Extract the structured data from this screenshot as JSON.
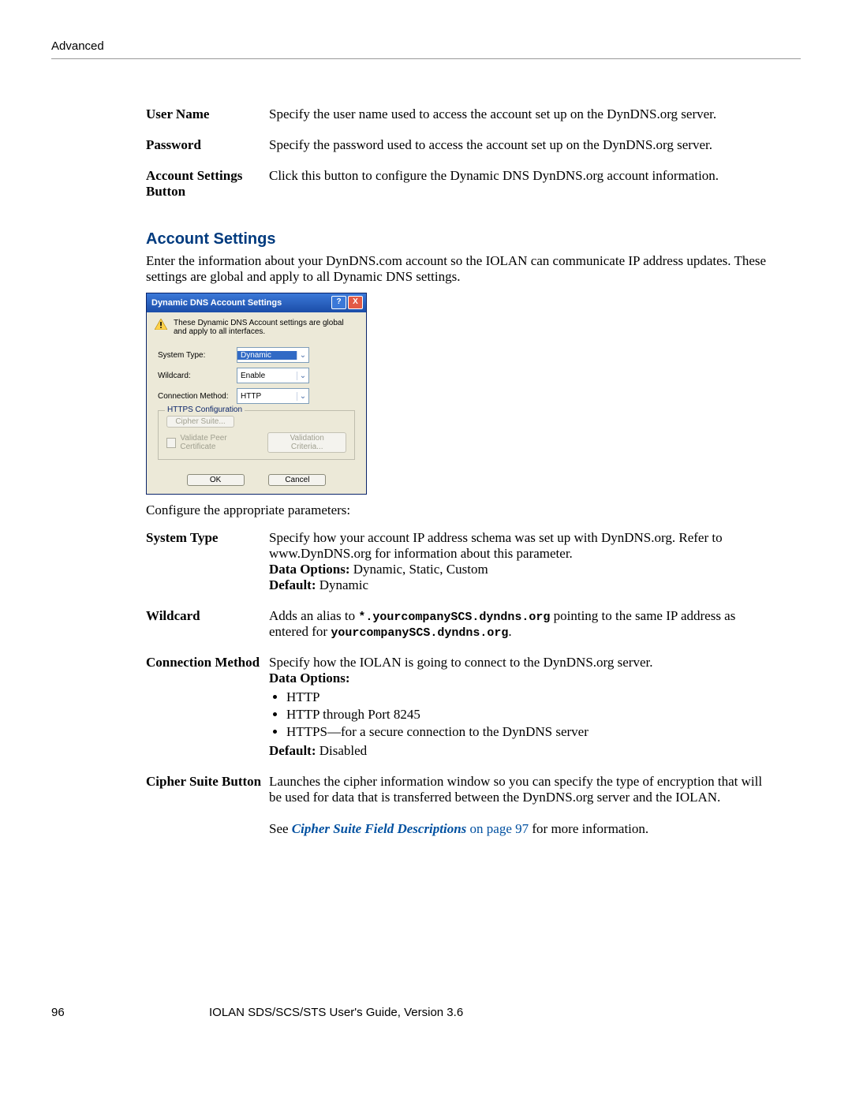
{
  "header": {
    "section": "Advanced"
  },
  "top_table": [
    {
      "term": "User Name",
      "desc": "Specify the user name used to access the account set up on the DynDNS.org server."
    },
    {
      "term": "Password",
      "desc": "Specify the password used to access the account set up on the DynDNS.org server."
    },
    {
      "term": "Account Settings Button",
      "desc": "Click this button to configure the Dynamic DNS DynDNS.org account information."
    }
  ],
  "sectionTitle": "Account Settings",
  "sectionIntro": "Enter the information about your DynDNS.com account so the IOLAN can communicate IP address updates. These settings are global and apply to all Dynamic DNS settings.",
  "dialog": {
    "title": "Dynamic DNS Account Settings",
    "warn": "These Dynamic DNS Account settings are global and apply to all interfaces.",
    "fields": {
      "systemType": {
        "label": "System Type:",
        "value": "Dynamic"
      },
      "wildcard": {
        "label": "Wildcard:",
        "value": "Enable"
      },
      "connMethod": {
        "label": "Connection Method:",
        "value": "HTTP"
      }
    },
    "httpsLegend": "HTTPS Configuration",
    "cipherSuiteBtn": "Cipher Suite...",
    "validateCheck": "Validate Peer Certificate",
    "validationBtn": "Validation Criteria...",
    "ok": "OK",
    "cancel": "Cancel"
  },
  "configLine": "Configure the appropriate parameters:",
  "paramTable": {
    "systemType": {
      "term": "System Type",
      "desc": "Specify how your account IP address schema was set up with DynDNS.org. Refer to www.DynDNS.org for information about this parameter.",
      "dataOptionsLabel": "Data Options:",
      "dataOptions": " Dynamic, Static, Custom",
      "defaultLabel": "Default:",
      "defaultVal": " Dynamic"
    },
    "wildcard": {
      "term": "Wildcard",
      "descPre": "Adds an alias to ",
      "code1": "*.yourcompanySCS.dyndns.org",
      "descMid": " pointing to the same IP address as entered for ",
      "code2": "yourcompanySCS.dyndns.org",
      "descEnd": "."
    },
    "connMethod": {
      "term": "Connection Method",
      "desc": "Specify how the IOLAN is going to connect to the DynDNS.org server.",
      "dataOptionsLabel": "Data Options:",
      "items": [
        "HTTP",
        "HTTP through Port 8245",
        "HTTPS—for a secure connection to the DynDNS server"
      ],
      "defaultLabel": "Default:",
      "defaultVal": " Disabled"
    },
    "cipher": {
      "term": "Cipher Suite Button",
      "desc": "Launches the cipher information window so you can specify the type of encryption that will be used for data that is transferred between the DynDNS.org server and the IOLAN.",
      "seePrefix": "See ",
      "link": "Cipher Suite Field Descriptions",
      "linkTail": " on page 97",
      "seeSuffix": " for more information."
    }
  },
  "footer": {
    "page": "96",
    "text": "IOLAN SDS/SCS/STS User's Guide, Version 3.6"
  }
}
